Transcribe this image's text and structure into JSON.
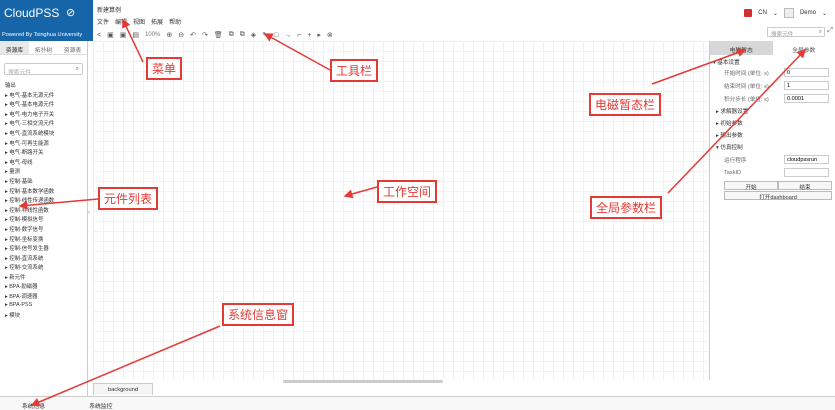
{
  "header": {
    "logo_text": "CloudPSS",
    "powered_by": "Powered By Tsinghua University",
    "doc_title": "新建算例",
    "menu": [
      "文件",
      "编辑",
      "视图",
      "拓展",
      "帮助"
    ],
    "language": "CN",
    "user": "Demo",
    "search_placeholder": "搜索元件"
  },
  "toolbar": {
    "zoom": "100%"
  },
  "sidebar": {
    "tabs": [
      "资源库",
      "拓扑树",
      "资源表"
    ],
    "search_placeholder": "搜索元件",
    "items": [
      "输出",
      "▸ 电气-基本无源元件",
      "▸ 电气-基本电源元件",
      "▸ 电气-电力电子开关",
      "▸ 电气-三相交流元件",
      "▸ 电气-直流系统模块",
      "▸ 电气-可再生能源",
      "▸ 电气-断路开关",
      "▸ 电气-母线",
      "▸ 量测",
      "▸ 控制-基础",
      "▸ 控制-基本数学函数",
      "▸ 控制-线性传递函数",
      "▸ 控制-非线性函数",
      "▸ 控制-模拟信号",
      "▸ 控制-数字信号",
      "▸ 控制-坐标变换",
      "▸ 控制-信号发生器",
      "▸ 控制-直流系统",
      "▸ 控制-交流系统",
      "▸ 新元件",
      "▸ BPA-励磁器",
      "▸ BPA-调速器",
      "▸ BPA-PSS",
      "▸ 模块"
    ]
  },
  "canvas": {
    "tab_label": "background"
  },
  "right_panel": {
    "tabs": [
      "电磁暂态",
      "全局参数"
    ],
    "section_basic": "▾ 基本设置",
    "fields": [
      {
        "label": "开始时间 (单位: s)",
        "value": "0"
      },
      {
        "label": "结束时间 (单位: s)",
        "value": "1"
      },
      {
        "label": "积分步长 (单位: s)",
        "value": "0.0001"
      }
    ],
    "sub_sections": [
      "▸ 求解器设置",
      "▸ 初始参数",
      "▸ 输出参数"
    ],
    "section_control": "▾ 仿真控制",
    "program_label": "运行程序",
    "program_value": "cloudpssrun",
    "taskid_label": "TaskID",
    "taskid_value": "",
    "start_label": "开始",
    "end_label": "结束",
    "dashboard_label": "打开dashboard"
  },
  "bottom_bar": {
    "tabs": [
      "系统信息",
      "系统监控"
    ]
  },
  "annotations": [
    {
      "id": "menu",
      "text": "菜单"
    },
    {
      "id": "toolbar",
      "text": "工具栏"
    },
    {
      "id": "emt",
      "text": "电磁暂态栏"
    },
    {
      "id": "components",
      "text": "元件列表"
    },
    {
      "id": "workspace",
      "text": "工作空间"
    },
    {
      "id": "global",
      "text": "全局参数栏"
    },
    {
      "id": "sysinfo",
      "text": "系统信息窗"
    }
  ],
  "colors": {
    "brand": "#1565a8",
    "annotation": "#e53935",
    "grid": "#eef1f5"
  }
}
